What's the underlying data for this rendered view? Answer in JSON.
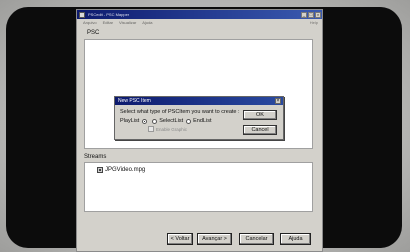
{
  "window": {
    "title": "PSCedit - PSC Mapper"
  },
  "menubar": {
    "items": [
      "Arquivo",
      "Editar",
      "Visualizar",
      "Ajuda"
    ],
    "help": "Help"
  },
  "psc_panel": {
    "label": "PSC"
  },
  "dialog": {
    "title": "New PSC Item",
    "question": "Select what type of PSCItem you want to create :",
    "options": [
      "PlayList",
      "SelectList",
      "EndList"
    ],
    "selected": "PlayList",
    "checkbox_label": "Enable Graphic",
    "ok_label": "OK",
    "cancel_label": "Cancel"
  },
  "streams_panel": {
    "label": "Streams",
    "items": [
      "JPGVideo.mpg"
    ]
  },
  "buttons": {
    "back": "< Voltar",
    "next": "Avançar >",
    "cancel": "Cancelar",
    "help": "Ajuda"
  },
  "colors": {
    "titlebar": "#0d1a6e",
    "window_bg": "#d3d1cb",
    "bezel": "#0c0c0c"
  }
}
